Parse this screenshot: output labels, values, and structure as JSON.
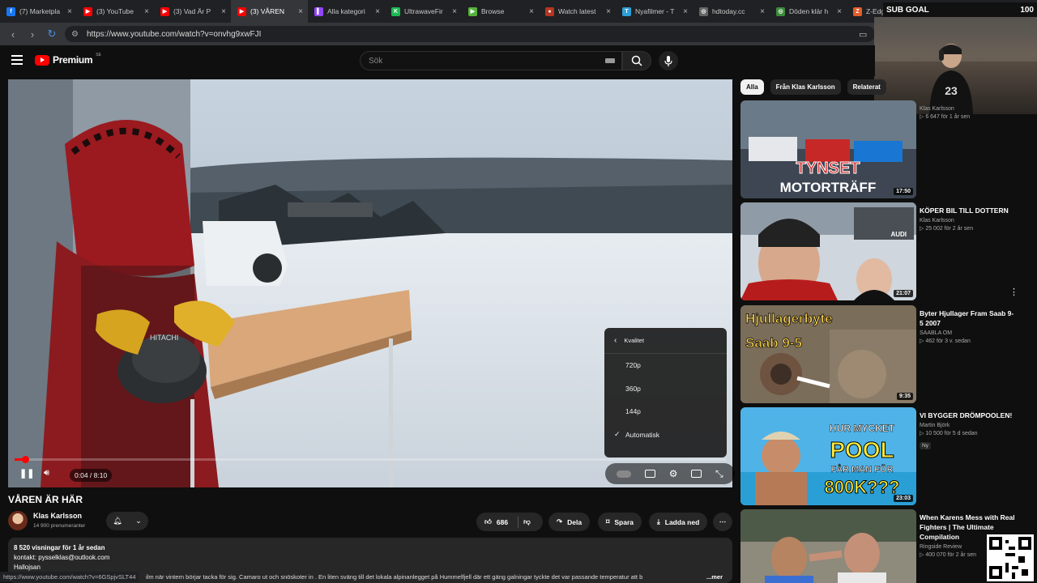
{
  "browser": {
    "tabs": [
      {
        "title": "(7) Marketpla",
        "fav": "#1877f2",
        "favtext": "f"
      },
      {
        "title": "(3) YouTube",
        "fav": "#ff0000",
        "favtext": "▶"
      },
      {
        "title": "(3) Vad Är P",
        "fav": "#ff0000",
        "favtext": "▶"
      },
      {
        "title": "(3) VÅREN",
        "fav": "#ff0000",
        "favtext": "▶"
      },
      {
        "title": "Alla kategori",
        "fav": "#9146ff",
        "favtext": "▌"
      },
      {
        "title": "UltrawaveFir",
        "fav": "#1db954",
        "favtext": "K"
      },
      {
        "title": "Browse",
        "fav": "#53b43a",
        "favtext": "▶"
      },
      {
        "title": "Watch latest",
        "fav": "#b5361f",
        "favtext": "●"
      },
      {
        "title": "Nyafilmer - T",
        "fav": "#2d9fd8",
        "favtext": "T"
      },
      {
        "title": "hdtoday.cc",
        "fav": "#666666",
        "favtext": "◎"
      },
      {
        "title": "Döden klär h",
        "fav": "#3b8c3b",
        "favtext": "◎"
      },
      {
        "title": "Z-Edge Ko",
        "fav": "#e35d2a",
        "favtext": "Z"
      }
    ],
    "url": "https://www.youtube.com/watch?v=onvhg9xwFJI",
    "sub_goal_label": "SUB GOAL",
    "sub_goal_value": "100"
  },
  "youtube": {
    "logo_text": "Premium",
    "logo_cc": "SE",
    "search_placeholder": "Sök"
  },
  "player": {
    "time": "0:04 / 8:10",
    "quality_header": "Kvalitet",
    "quality_options": [
      "720p",
      "360p",
      "144p",
      "Automatisk"
    ]
  },
  "video": {
    "title": "VÅREN ÄR HÄR",
    "channel": "Klas Karlsson",
    "subscribers": "14 900 prenumeranter",
    "likes": "686",
    "share": "Dela",
    "save": "Spara",
    "download": "Ladda ned",
    "desc_views": "8 520 visningar  för 1 år sedan",
    "desc_contact": "kontakt: pysselklas@outlook.com",
    "desc_line3": "Hallojsan",
    "desc_tail": "ilm när vintern börjar tacka för sig. Camaro ut och snöskoter in . En liten sväng till det lokala alpinanlegget på Hummelfjell där ett gäng galningar tyckte det var passande temperatur att b",
    "desc_more": "...mer"
  },
  "statusbar_url": "https://www.youtube.com/watch?v=6GSpjvSLT44",
  "chips": [
    "Alla",
    "Från Klas Karlsson",
    "Relaterat"
  ],
  "recommendations": [
    {
      "title": "",
      "channel": "Klas Karlsson",
      "views": "6 647  för 1 år sen",
      "duration": "17:50",
      "thumb_text": "TYNSET MOTORTRÄFF"
    },
    {
      "title": "KÖPER BIL TILL DOTTERN",
      "channel": "Klas Karlsson",
      "views": "25 002  för 2 år sen",
      "duration": "21:07",
      "thumb_text": "AUDI"
    },
    {
      "title": "Byter Hjullager Fram Saab 9-5 2007",
      "channel": "SAABLA OM",
      "views": "462  för 3 v. sedan",
      "duration": "9:35",
      "thumb_text": "Hjullagerbyte Saab 9-5"
    },
    {
      "title": "VI BYGGER DRÖMPOOLEN!",
      "channel": "Martin Björk",
      "views": "10 500  för 5 d sedan",
      "duration": "23:03",
      "badge": "Ny",
      "thumb_text": "HUR MYCKET POOL FÅR MAN FÖR 800K???"
    },
    {
      "title": "When Karens Mess with Real Fighters | The Ultimate Compilation",
      "channel": "Ringside Review",
      "views": "400 070  för 2 år sen",
      "duration": "",
      "thumb_text": ""
    }
  ],
  "colors": {
    "accent": "#ff0000",
    "bg": "#0f0f0f",
    "surface": "#272727"
  }
}
